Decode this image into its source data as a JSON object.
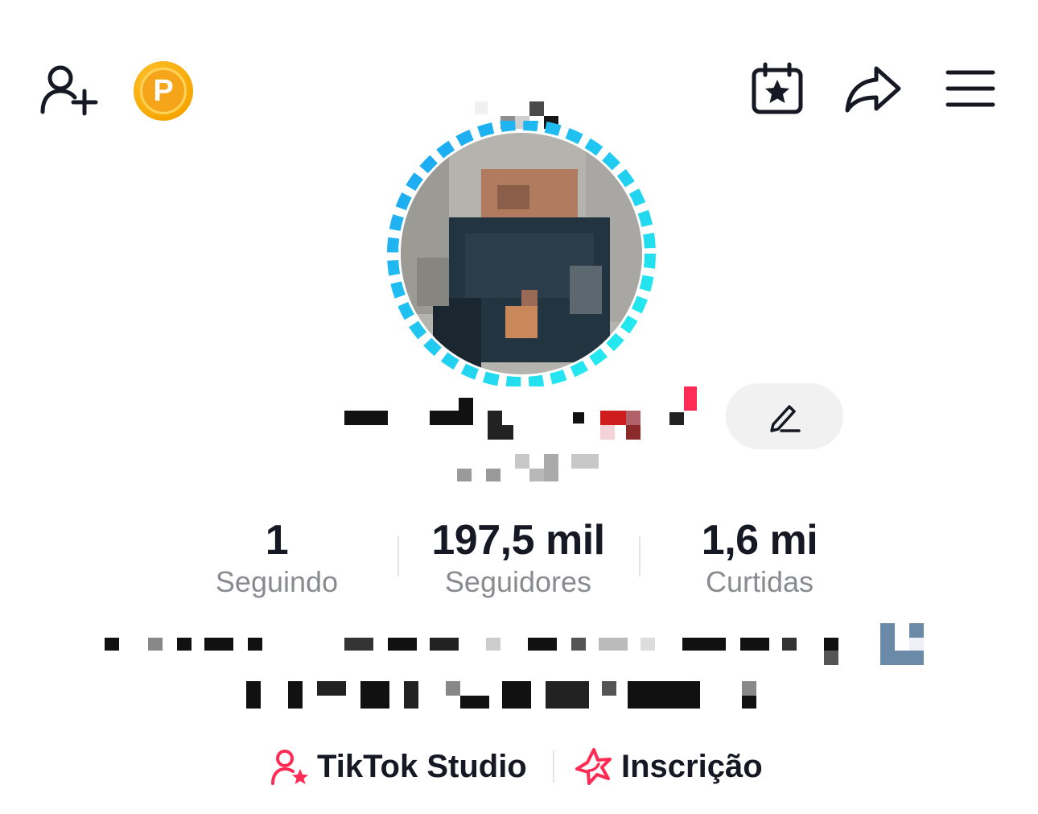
{
  "header": {
    "coin_letter": "P",
    "icons": [
      "add-user-icon",
      "coin-icon",
      "calendar-star-icon",
      "share-icon",
      "menu-icon"
    ]
  },
  "profile": {
    "edit_icon": "pencil-icon"
  },
  "stats": [
    {
      "value": "1",
      "label": "Seguindo"
    },
    {
      "value": "197,5 mil",
      "label": "Seguidores"
    },
    {
      "value": "1,6 mi",
      "label": "Curtidas"
    }
  ],
  "links": [
    {
      "label": "TikTok Studio",
      "icon": "user-star-icon"
    },
    {
      "label": "Inscrição",
      "icon": "star-badge-icon"
    }
  ],
  "colors": {
    "text": "#161823",
    "muted": "#8a8b91",
    "accent": "#fe2c55",
    "coin": "#f7a600",
    "ring_blue": "#1da1f2",
    "ring_cyan": "#25f4ee"
  }
}
